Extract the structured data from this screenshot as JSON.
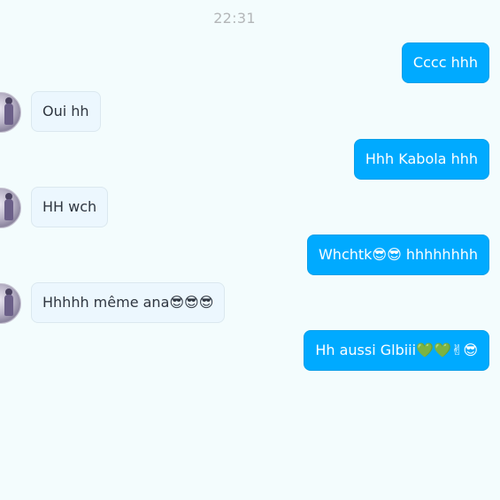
{
  "chat": {
    "timestamp": "22:31",
    "messages": [
      {
        "direction": "out",
        "text": "Cccc hhh"
      },
      {
        "direction": "in",
        "text": "Oui hh"
      },
      {
        "direction": "out",
        "text": "Hhh Kabola hhh"
      },
      {
        "direction": "in",
        "text": "HH wch"
      },
      {
        "direction": "out",
        "text": "Whchtk😎😎 hhhhhhhh"
      },
      {
        "direction": "in",
        "text": "Hhhhh même ana😎😎😎"
      },
      {
        "direction": "out",
        "text": "Hh aussi Glbiii💚💚✌😎"
      }
    ]
  },
  "colors": {
    "background": "#f3fcfd",
    "outgoing_bubble": "#00aaff",
    "incoming_bubble": "#ecf7fe",
    "timestamp_text": "#b3b6b8"
  },
  "icons": {
    "avatar": "contact-avatar-photo"
  }
}
